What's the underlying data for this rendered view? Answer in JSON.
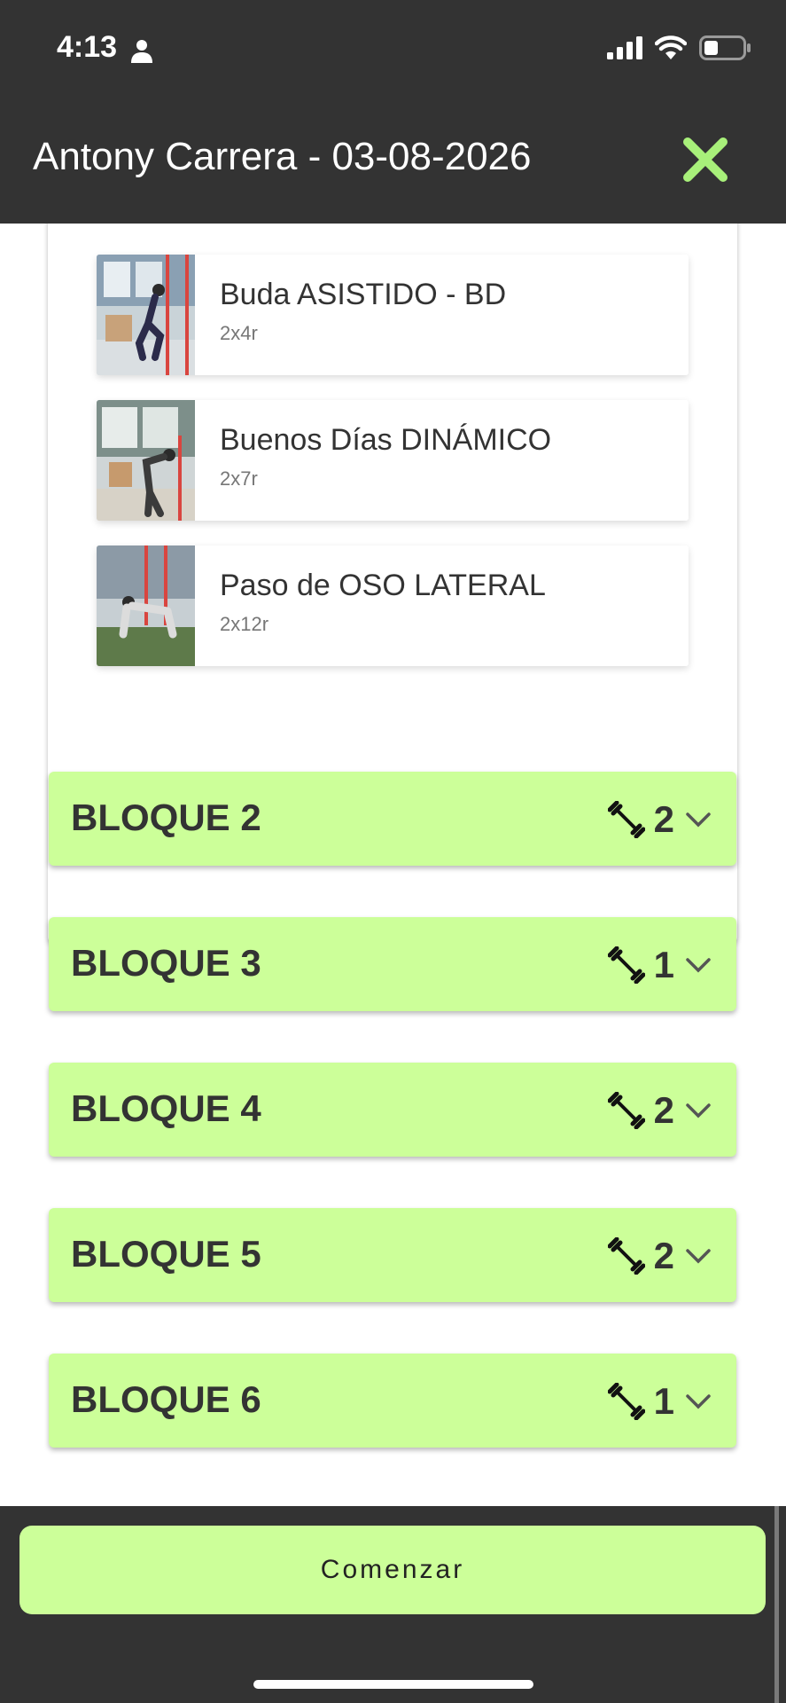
{
  "status_bar": {
    "time": "4:13",
    "battery_level": 0.35
  },
  "header": {
    "title": "Antony Carrera - 03-08-2026"
  },
  "exercises": [
    {
      "name": "Buda ASISTIDO - BD",
      "sets": "2x4r",
      "thumbnail": "exercise-photo-squat"
    },
    {
      "name": "Buenos Días DINÁMICO",
      "sets": "2x7r",
      "thumbnail": "exercise-photo-good-morning"
    },
    {
      "name": "Paso de OSO LATERAL",
      "sets": "2x12r",
      "thumbnail": "exercise-photo-bear-crawl"
    }
  ],
  "blocks": [
    {
      "title": "BLOQUE 2",
      "count": "2"
    },
    {
      "title": "BLOQUE 3",
      "count": "1"
    },
    {
      "title": "BLOQUE 4",
      "count": "2"
    },
    {
      "title": "BLOQUE 5",
      "count": "2"
    },
    {
      "title": "BLOQUE 6",
      "count": "1"
    }
  ],
  "footer": {
    "start_label": "Comenzar"
  },
  "colors": {
    "accent": "#ccff99",
    "dark": "#333333",
    "close": "#a8f07a"
  }
}
